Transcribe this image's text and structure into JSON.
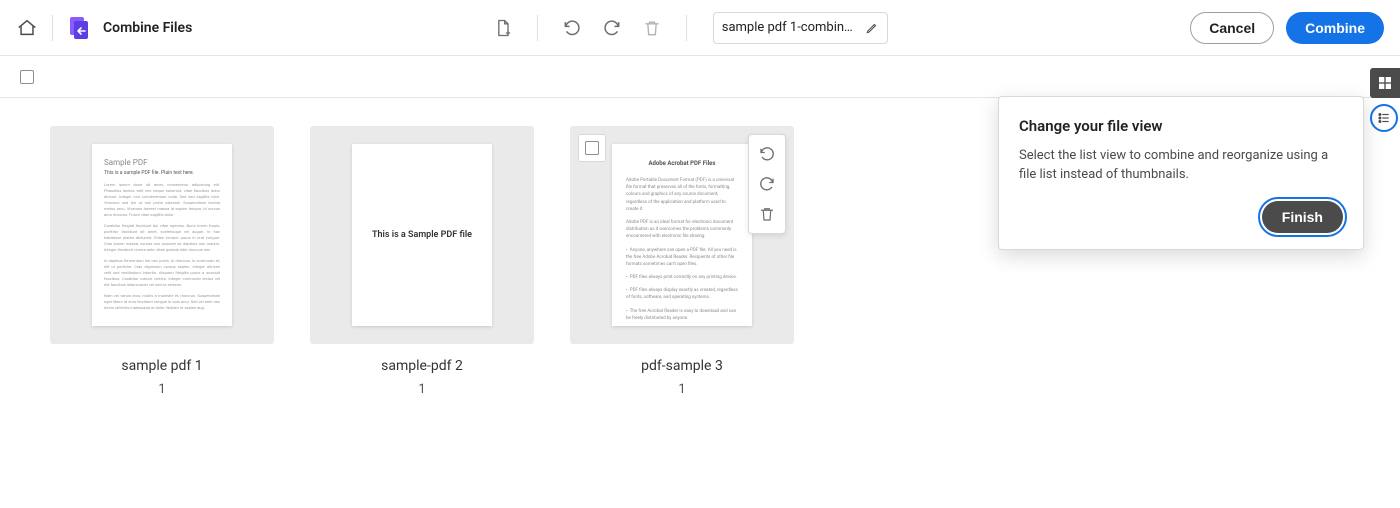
{
  "header": {
    "title": "Combine Files",
    "filename": "sample pdf 1-combin…",
    "cancel_label": "Cancel",
    "combine_label": "Combine"
  },
  "files": [
    {
      "name": "sample pdf 1",
      "pages": "1",
      "preview_kind": "lorem",
      "preview_title": "Sample PDF",
      "preview_sub": "This is a sample PDF file. Plain text here."
    },
    {
      "name": "sample-pdf 2",
      "pages": "1",
      "preview_kind": "center",
      "preview_center_text": "This is a Sample PDF file"
    },
    {
      "name": "pdf-sample 3",
      "pages": "1",
      "preview_kind": "doc3",
      "preview3_title": "Adobe Acrobat PDF Files"
    }
  ],
  "coach": {
    "title": "Change your file view",
    "body": "Select the list view to combine and reorganize using a file list instead of thumbnails.",
    "finish_label": "Finish"
  },
  "icons": {
    "home": "home-icon",
    "app": "combine-files-app-icon",
    "add_file": "add-file-icon",
    "undo": "undo-icon",
    "redo": "redo-icon",
    "delete": "trash-icon",
    "edit": "pencil-icon",
    "thumb_view": "thumbnail-view-icon",
    "list_view": "list-view-icon"
  }
}
